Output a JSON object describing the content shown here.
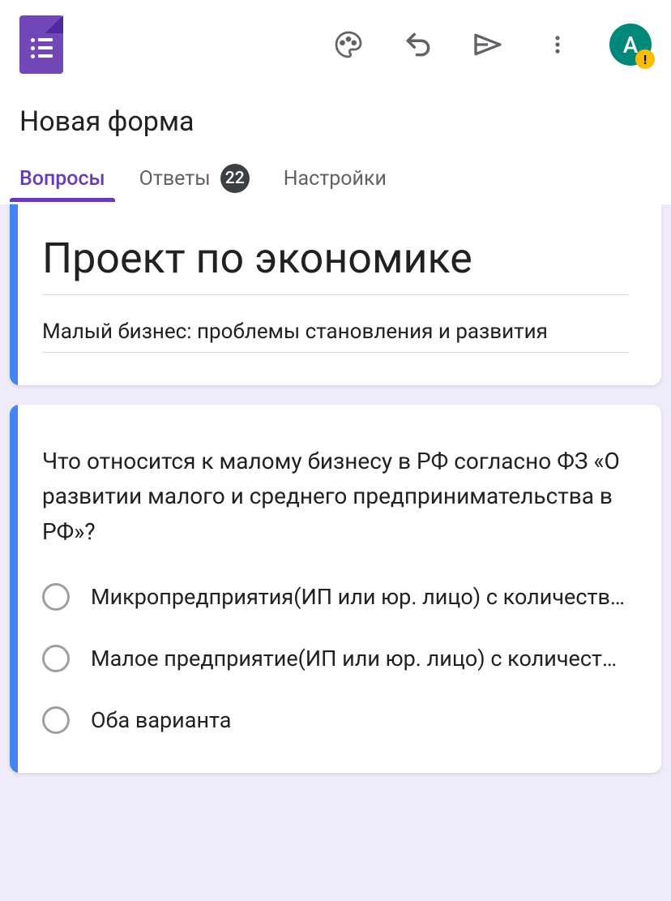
{
  "header": {
    "formName": "Новая форма",
    "avatarInitial": "A"
  },
  "tabs": {
    "questions": "Вопросы",
    "responses": "Ответы",
    "responsesCount": "22",
    "settings": "Настройки"
  },
  "titleCard": {
    "title": "Проект по экономике",
    "description": "Малый бизнес: проблемы становления и развития"
  },
  "question1": {
    "text": "Что относится к малому бизнесу в РФ согласно ФЗ «О развитии малого и среднего предпринимательства в РФ»?",
    "options": [
      "Микропредприятия(ИП или юр. лицо) с количеств…",
      "Малое предприятие(ИП или юр. лицо) с количест…",
      "Оба варианта"
    ]
  }
}
